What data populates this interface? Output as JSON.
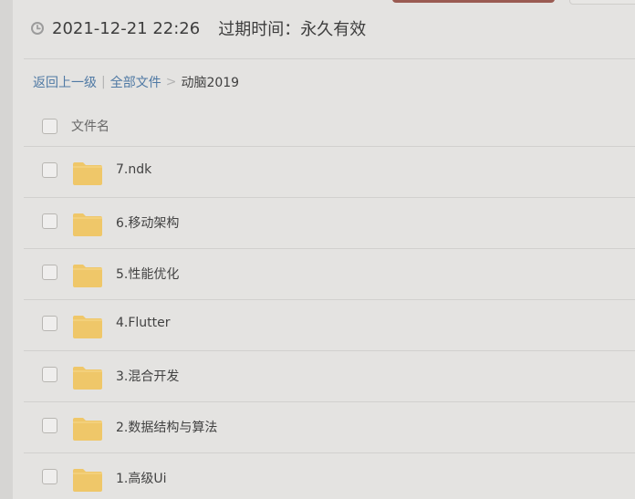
{
  "share_meta": {
    "date": "2021-12-21 22:26",
    "expiry": "过期时间：永久有效"
  },
  "breadcrumb": {
    "back_label": "返回上一级",
    "separator": "|",
    "all_files_label": "全部文件",
    "chevron": ">",
    "current_folder": "动脑2019"
  },
  "table": {
    "header_label": "文件名",
    "rows": [
      {
        "name": "7.ndk"
      },
      {
        "name": "6.移动架构"
      },
      {
        "name": "5.性能优化"
      },
      {
        "name": "4.Flutter"
      },
      {
        "name": "3.混合开发"
      },
      {
        "name": "2.数据结构与算法"
      },
      {
        "name": "1.高级Ui"
      }
    ]
  },
  "icons": {
    "clock": "clock-icon",
    "folder": "folder-icon"
  },
  "colors": {
    "background": "#e4e3e1",
    "link": "#4f79a4",
    "folder": "#efc769",
    "top_button": "#9a5b52"
  }
}
